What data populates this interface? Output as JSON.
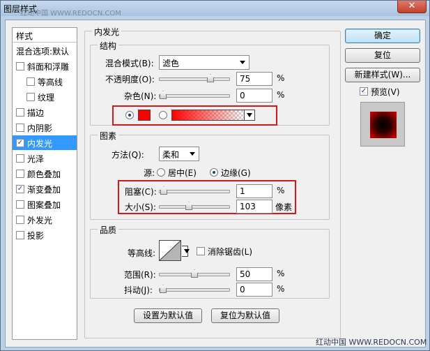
{
  "window": {
    "title": "图层样式",
    "close_glyph": "✕"
  },
  "watermark": {
    "top": "红动中国 WWW.REDOCN.COM",
    "bottom": "红动中国 WWW.REDOCN.COM"
  },
  "style_list": {
    "header": "样式",
    "items": [
      {
        "label": "混合选项:默认",
        "checkbox": false,
        "checked": false,
        "selected": false
      },
      {
        "label": "斜面和浮雕",
        "checkbox": true,
        "checked": false,
        "selected": false
      },
      {
        "label": "等高线",
        "checkbox": true,
        "checked": false,
        "selected": false,
        "indent": true
      },
      {
        "label": "纹理",
        "checkbox": true,
        "checked": false,
        "selected": false,
        "indent": true
      },
      {
        "label": "描边",
        "checkbox": true,
        "checked": false,
        "selected": false
      },
      {
        "label": "内阴影",
        "checkbox": true,
        "checked": false,
        "selected": false
      },
      {
        "label": "内发光",
        "checkbox": true,
        "checked": true,
        "selected": true
      },
      {
        "label": "光泽",
        "checkbox": true,
        "checked": false,
        "selected": false
      },
      {
        "label": "颜色叠加",
        "checkbox": true,
        "checked": false,
        "selected": false
      },
      {
        "label": "渐变叠加",
        "checkbox": true,
        "checked": true,
        "selected": false
      },
      {
        "label": "图案叠加",
        "checkbox": true,
        "checked": false,
        "selected": false
      },
      {
        "label": "外发光",
        "checkbox": true,
        "checked": false,
        "selected": false
      },
      {
        "label": "投影",
        "checkbox": true,
        "checked": false,
        "selected": false
      }
    ]
  },
  "inner_glow": {
    "title": "内发光",
    "structure": {
      "title": "结构",
      "blend_mode_label": "混合模式(B):",
      "blend_mode_value": "滤色",
      "opacity_label": "不透明度(O):",
      "opacity_value": "75",
      "opacity_unit": "%",
      "opacity_level": 0.75,
      "noise_label": "杂色(N):",
      "noise_value": "0",
      "noise_unit": "%",
      "noise_level": 0,
      "color_hex": "#ff0000"
    },
    "elements": {
      "title": "图素",
      "technique_label": "方法(Q):",
      "technique_value": "柔和",
      "source_label": "源:",
      "source_center": "居中(E)",
      "source_edge": "边缘(G)",
      "choke_label": "阻塞(C):",
      "choke_value": "1",
      "choke_unit": "%",
      "choke_level": 0.01,
      "size_label": "大小(S):",
      "size_value": "103",
      "size_unit": "像素",
      "size_level": 0.41
    },
    "quality": {
      "title": "品质",
      "contour_label": "等高线:",
      "anti_alias_label": "消除锯齿(L)",
      "range_label": "范围(R):",
      "range_value": "50",
      "range_unit": "%",
      "range_level": 0.5,
      "jitter_label": "抖动(J):",
      "jitter_value": "0",
      "jitter_unit": "%",
      "jitter_level": 0
    },
    "make_default": "设置为默认值",
    "reset_default": "复位为默认值"
  },
  "buttons": {
    "ok": "确定",
    "reset": "复位",
    "new_style": "新建样式(W)...",
    "preview_label": "预览(V)"
  },
  "colors": {
    "accent_selection": "#3399ff",
    "highlight_box": "#d11a1a",
    "glow": "#ff0000"
  }
}
